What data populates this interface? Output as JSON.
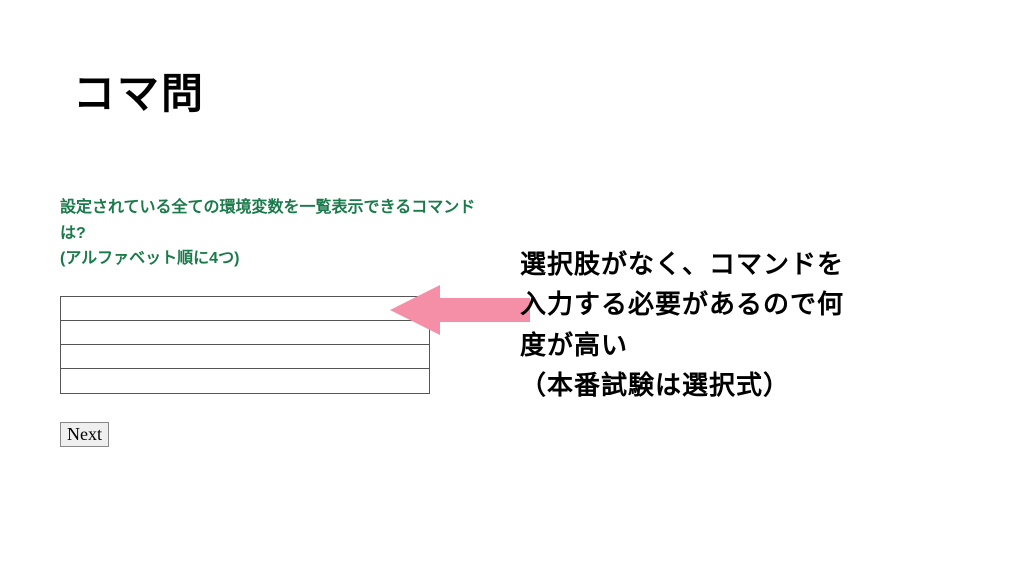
{
  "title": "コマ問",
  "quiz": {
    "question_line1": "設定されている全ての環境変数を一覧表示できるコマンドは?",
    "question_line2": "(アルファベット順に4つ)",
    "inputs": [
      "",
      "",
      "",
      ""
    ],
    "next_label": "Next"
  },
  "annotation": {
    "line1": "選択肢がなく、コマンドを",
    "line2": "入力する必要があるので何",
    "line3": "度が高い",
    "line4": "（本番試験は選択式）"
  },
  "colors": {
    "question": "#1a7a4a",
    "arrow": "#f58fa8"
  }
}
